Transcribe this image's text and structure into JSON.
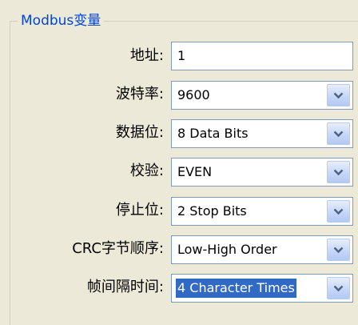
{
  "group": {
    "title": "Modbus变量"
  },
  "fields": [
    {
      "label": "地址:",
      "value": "1",
      "type": "text"
    },
    {
      "label": "波特率:",
      "value": "9600",
      "type": "combo"
    },
    {
      "label": "数据位:",
      "value": "8 Data Bits",
      "type": "combo"
    },
    {
      "label": "校验:",
      "value": "EVEN",
      "type": "combo"
    },
    {
      "label": "停止位:",
      "value": "2 Stop Bits",
      "type": "combo"
    },
    {
      "label": "CRC字节顺序:",
      "value": "Low-High Order",
      "type": "combo"
    },
    {
      "label": "帧间隔时间:",
      "value": "4 Character Times",
      "type": "combo"
    }
  ],
  "icons": {
    "dropdown": "chevron-down-icon"
  },
  "colors": {
    "window_background": "#ECE9D8",
    "group_title": "#0046D5",
    "field_border": "#7F9DB9",
    "selection": "#316AC5",
    "arrow": "#4D6185"
  }
}
